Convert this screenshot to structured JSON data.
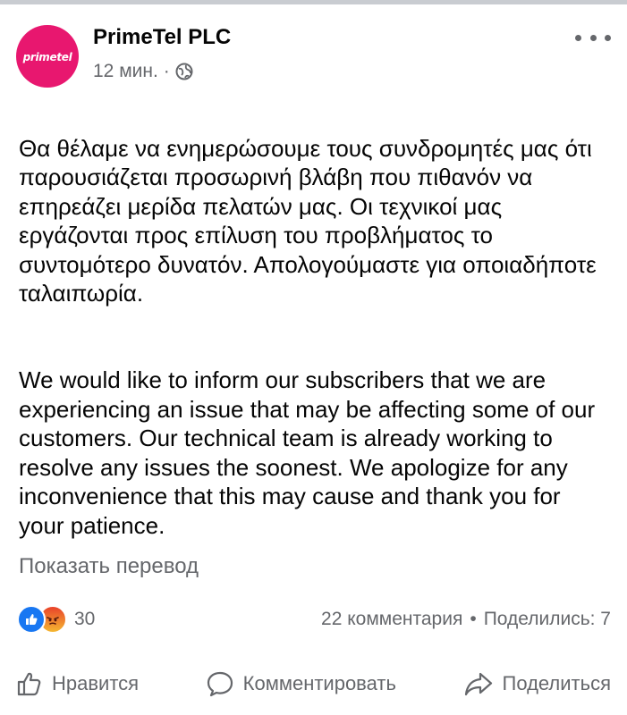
{
  "post": {
    "page_name": "PrimeTel PLC",
    "avatar_text": "primetel",
    "time": "12 мин.",
    "separator": "·",
    "paragraphs": [
      "Θα θέλαμε να ενημερώσουμε τους συνδρομητές μας ότι παρουσιάζεται  προσωρινή βλάβη που πιθανόν να επηρεάζει μερίδα πελατών μας. Οι τεχνικοί μας εργάζονται προς επίλυση του προβλήματος το συντομότερο δυνατόν. Απολογούμαστε για οποιαδήποτε ταλαιπωρία.",
      "We would like to inform our subscribers that we are experiencing an issue that may be affecting some of our customers. Our technical team is already working to resolve any issues the soonest. We apologize for any inconvenience that this may cause and thank you for your patience."
    ],
    "translate_label": "Показать перевод"
  },
  "stats": {
    "reaction_count": "30",
    "comments": "22 комментария",
    "dot": "•",
    "shares": "Поделились: 7"
  },
  "actions": {
    "like": "Нравится",
    "comment": "Комментировать",
    "share": "Поделиться"
  },
  "colors": {
    "brand": "#e8176f",
    "like_blue": "#1877f2",
    "secondary_text": "#65676b"
  },
  "icons": [
    "globe-icon",
    "more-icon",
    "like-reaction-icon",
    "angry-reaction-icon",
    "thumbs-up-icon",
    "comment-icon",
    "share-icon"
  ]
}
